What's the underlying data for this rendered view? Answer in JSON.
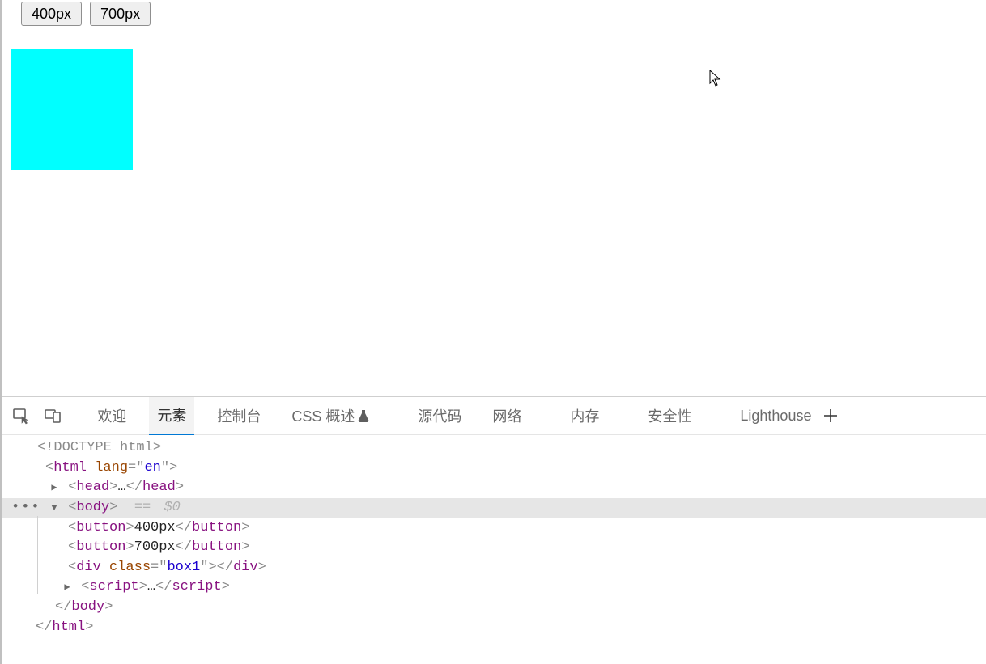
{
  "page": {
    "buttons": {
      "b400": "400px",
      "b700": "700px"
    },
    "box_color": "#00ffff"
  },
  "devtools": {
    "tabs": {
      "welcome": "欢迎",
      "elements": "元素",
      "console": "控制台",
      "css_overview": "CSS 概述",
      "sources": "源代码",
      "network": "网络",
      "memory": "内存",
      "security": "安全性",
      "lighthouse": "Lighthouse"
    },
    "active_tab": "elements",
    "dom": {
      "doctype": "<!DOCTYPE html>",
      "html_open": {
        "tag": "html",
        "attr": "lang",
        "val": "en"
      },
      "head": {
        "tag": "head",
        "ellipsis": "…"
      },
      "body_open": {
        "tag": "body",
        "annotation": "== $0"
      },
      "button1": {
        "tag": "button",
        "text": "400px"
      },
      "button2": {
        "tag": "button",
        "text": "700px"
      },
      "div_box": {
        "tag": "div",
        "attr": "class",
        "val": "box1"
      },
      "script": {
        "tag": "script",
        "ellipsis": "…"
      },
      "body_close": {
        "tag": "body"
      },
      "html_close": {
        "tag": "html"
      }
    }
  }
}
